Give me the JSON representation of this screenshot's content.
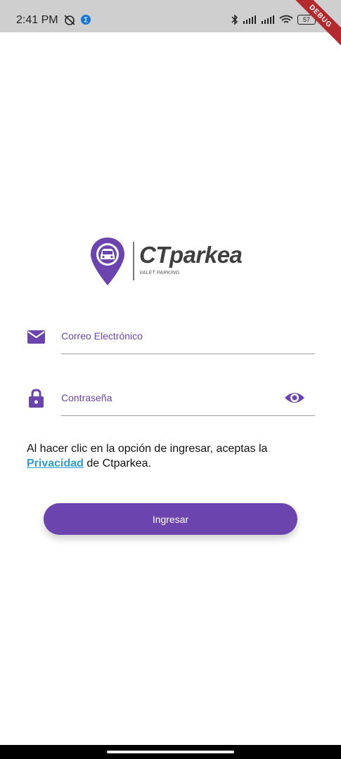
{
  "status_bar": {
    "time": "2:41 PM",
    "battery": "57",
    "icons": [
      "muted-alarm-icon",
      "sync-icon",
      "bluetooth-icon",
      "signal-icon",
      "signal-icon",
      "wifi-icon",
      "battery-icon"
    ]
  },
  "debug_banner": "DEBUG",
  "logo": {
    "brand": "CTparkea",
    "tagline": "VALET PARKING",
    "accent": "#6b45ad"
  },
  "form": {
    "email_label": "Correo Electrónico",
    "password_label": "Contraseña"
  },
  "privacy": {
    "prefix": "Al hacer clic en la opción de ingresar, aceptas la",
    "link": "Privacidad",
    "suffix": " de Ctparkea."
  },
  "login_button": "Ingresar",
  "colors": {
    "primary": "#6b45ad",
    "link": "#2d9bd6"
  }
}
